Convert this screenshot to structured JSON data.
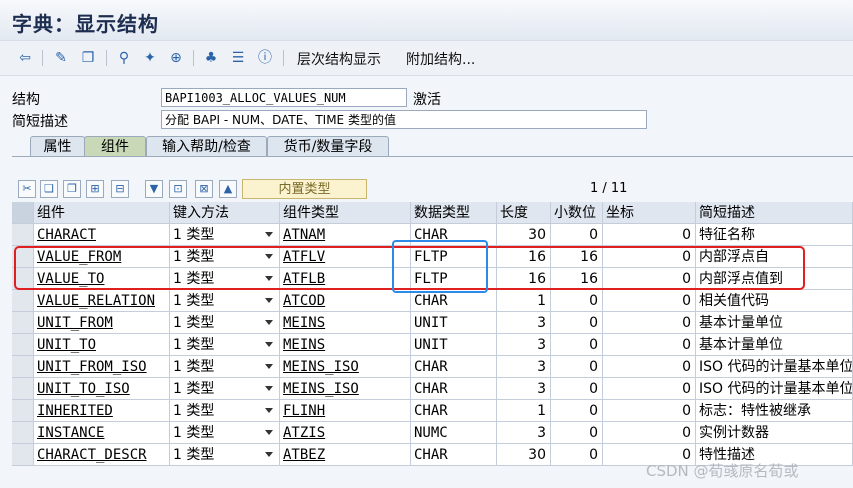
{
  "window": {
    "title": "字典：显示结构"
  },
  "toolbar": {
    "hierarchy_label": "层次结构显示",
    "append_label": "附加结构..."
  },
  "header": {
    "structure_label": "结构",
    "structure_value": "BAPI1003_ALLOC_VALUES_NUM",
    "status": "激活",
    "desc_label": "简短描述",
    "desc_value": "分配 BAPI - NUM、DATE、TIME 类型的值"
  },
  "tabs": [
    {
      "label": "属性",
      "active": false
    },
    {
      "label": "组件",
      "active": true
    },
    {
      "label": "输入帮助/检查",
      "active": false
    },
    {
      "label": "货币/数量字段",
      "active": false
    }
  ],
  "grid_toolbar": {
    "builtin_type": "内置类型",
    "pager": "1 / 11"
  },
  "columns": [
    "组件",
    "键入方法",
    "组件类型",
    "数据类型",
    "长度",
    "小数位",
    "坐标",
    "简短描述"
  ],
  "rows": [
    {
      "component": "CHARACT",
      "typing": "1 类型",
      "comptype": "ATNAM",
      "datatype": "CHAR",
      "length": "30",
      "decimals": "0",
      "coord": "0",
      "desc": "特征名称"
    },
    {
      "component": "VALUE_FROM",
      "typing": "1 类型",
      "comptype": "ATFLV",
      "datatype": "FLTP",
      "length": "16",
      "decimals": "16",
      "coord": "0",
      "desc": "内部浮点自"
    },
    {
      "component": "VALUE_TO",
      "typing": "1 类型",
      "comptype": "ATFLB",
      "datatype": "FLTP",
      "length": "16",
      "decimals": "16",
      "coord": "0",
      "desc": "内部浮点值到"
    },
    {
      "component": "VALUE_RELATION",
      "typing": "1 类型",
      "comptype": "ATCOD",
      "datatype": "CHAR",
      "length": "1",
      "decimals": "0",
      "coord": "0",
      "desc": "相关值代码"
    },
    {
      "component": "UNIT_FROM",
      "typing": "1 类型",
      "comptype": "MEINS",
      "datatype": "UNIT",
      "length": "3",
      "decimals": "0",
      "coord": "0",
      "desc": "基本计量单位"
    },
    {
      "component": "UNIT_TO",
      "typing": "1 类型",
      "comptype": "MEINS",
      "datatype": "UNIT",
      "length": "3",
      "decimals": "0",
      "coord": "0",
      "desc": "基本计量单位"
    },
    {
      "component": "UNIT_FROM_ISO",
      "typing": "1 类型",
      "comptype": "MEINS_ISO",
      "datatype": "CHAR",
      "length": "3",
      "decimals": "0",
      "coord": "0",
      "desc": "ISO 代码的计量基本单位"
    },
    {
      "component": "UNIT_TO_ISO",
      "typing": "1 类型",
      "comptype": "MEINS_ISO",
      "datatype": "CHAR",
      "length": "3",
      "decimals": "0",
      "coord": "0",
      "desc": "ISO 代码的计量基本单位"
    },
    {
      "component": "INHERITED",
      "typing": "1 类型",
      "comptype": "FLINH",
      "datatype": "CHAR",
      "length": "1",
      "decimals": "0",
      "coord": "0",
      "desc": "标志：特性被继承"
    },
    {
      "component": "INSTANCE",
      "typing": "1 类型",
      "comptype": "ATZIS",
      "datatype": "NUMC",
      "length": "3",
      "decimals": "0",
      "coord": "0",
      "desc": "实例计数器"
    },
    {
      "component": "CHARACT_DESCR",
      "typing": "1 类型",
      "comptype": "ATBEZ",
      "datatype": "CHAR",
      "length": "30",
      "decimals": "0",
      "coord": "0",
      "desc": "特性描述"
    }
  ],
  "watermark": "CSDN @荀彧原名荀或",
  "colors": {
    "highlight_red": "#e02020",
    "highlight_blue": "#2d8be8",
    "active_tab": "#c9d9b8"
  }
}
